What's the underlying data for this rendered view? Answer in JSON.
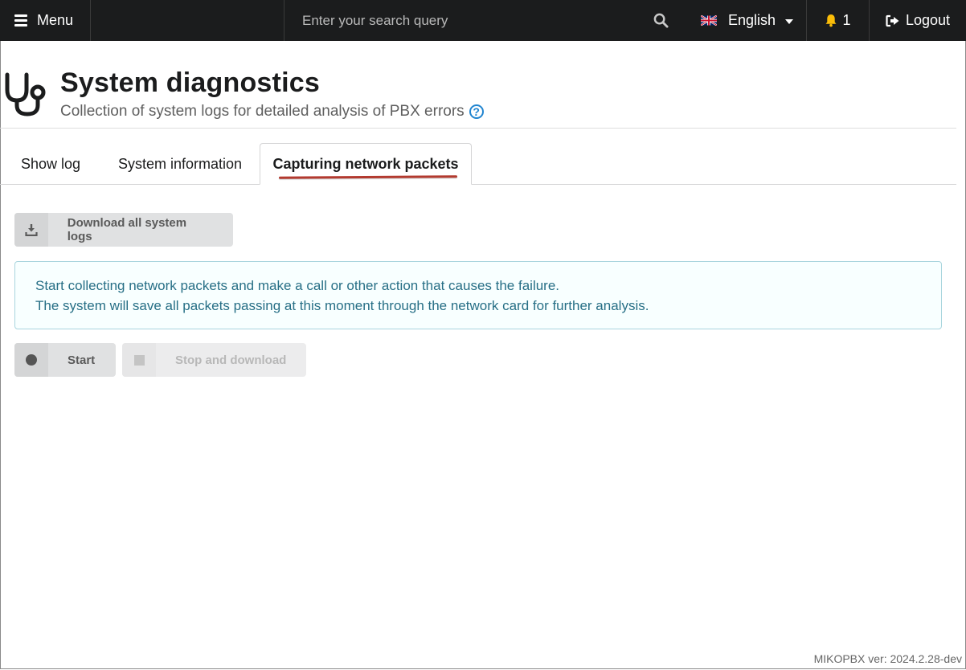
{
  "topbar": {
    "menu_label": "Menu",
    "search_placeholder": "Enter your search query",
    "language": "English",
    "notifications_count": "1",
    "logout_label": "Logout"
  },
  "header": {
    "title": "System diagnostics",
    "subtitle": "Collection of system logs for detailed analysis of PBX errors"
  },
  "tabs": [
    {
      "label": "Show log",
      "active": false
    },
    {
      "label": "System information",
      "active": false
    },
    {
      "label": "Capturing network packets",
      "active": true
    }
  ],
  "actions": {
    "download_all_label": "Download all system logs"
  },
  "info": {
    "line1": "Start collecting network packets and make a call or other action that causes the failure.",
    "line2": "The system will save all packets passing at this moment through the network card for further analysis."
  },
  "capture": {
    "start_label": "Start",
    "stop_label": "Stop and download"
  },
  "footer": {
    "version": "MIKOPBX ver: 2024.2.28-dev"
  },
  "colors": {
    "topbar_bg": "#1b1c1d",
    "bell": "#fbbd08",
    "help": "#2185d0",
    "info_text": "#276f86",
    "tab_underline": "#b33a2f"
  }
}
